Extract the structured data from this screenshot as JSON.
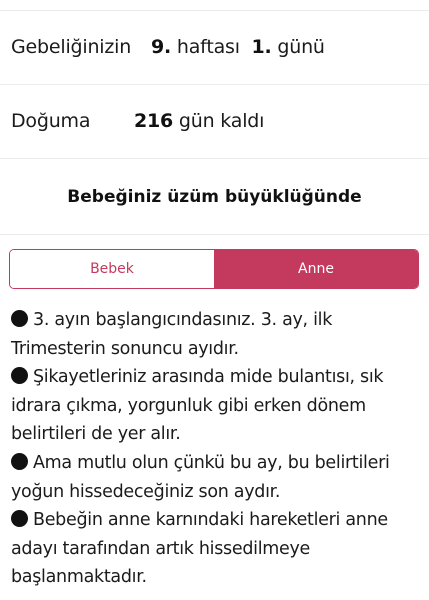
{
  "week_info": {
    "label": "Gebeliğinizin",
    "week_number": "9.",
    "week_text": "haftası",
    "day_number": "1.",
    "day_text": "günü"
  },
  "birth_info": {
    "label": "Doğuma",
    "days_number": "216",
    "days_text": "gün kaldı"
  },
  "size_title": "Bebeğiniz üzüm büyüklüğünde",
  "tabs": {
    "baby_label": "Bebek",
    "mother_label": "Anne",
    "selected": "Anne"
  },
  "content": {
    "paragraphs": [
      "3. ayın başlangıcındasınız. 3. ay, ilk Trimesterin sonuncu ayıdır.",
      "Şikayetleriniz arasında mide bulantısı, sık idrara çıkma, yorgunluk gibi erken dönem belirtileri de yer alır.",
      "Ama mutlu olun çünkü bu ay, bu belirtileri yoğun hissedeceğiniz son aydır.",
      "Bebeğin anne karnındaki hareketleri anne adayı tarafından artık hissedilmeye başlanmaktadır."
    ]
  },
  "colors": {
    "accent": "#c43a5e",
    "divider": "#ececec",
    "text": "#1b1b1b"
  },
  "icons": {
    "bullet": "black-circle-bullet-icon"
  }
}
